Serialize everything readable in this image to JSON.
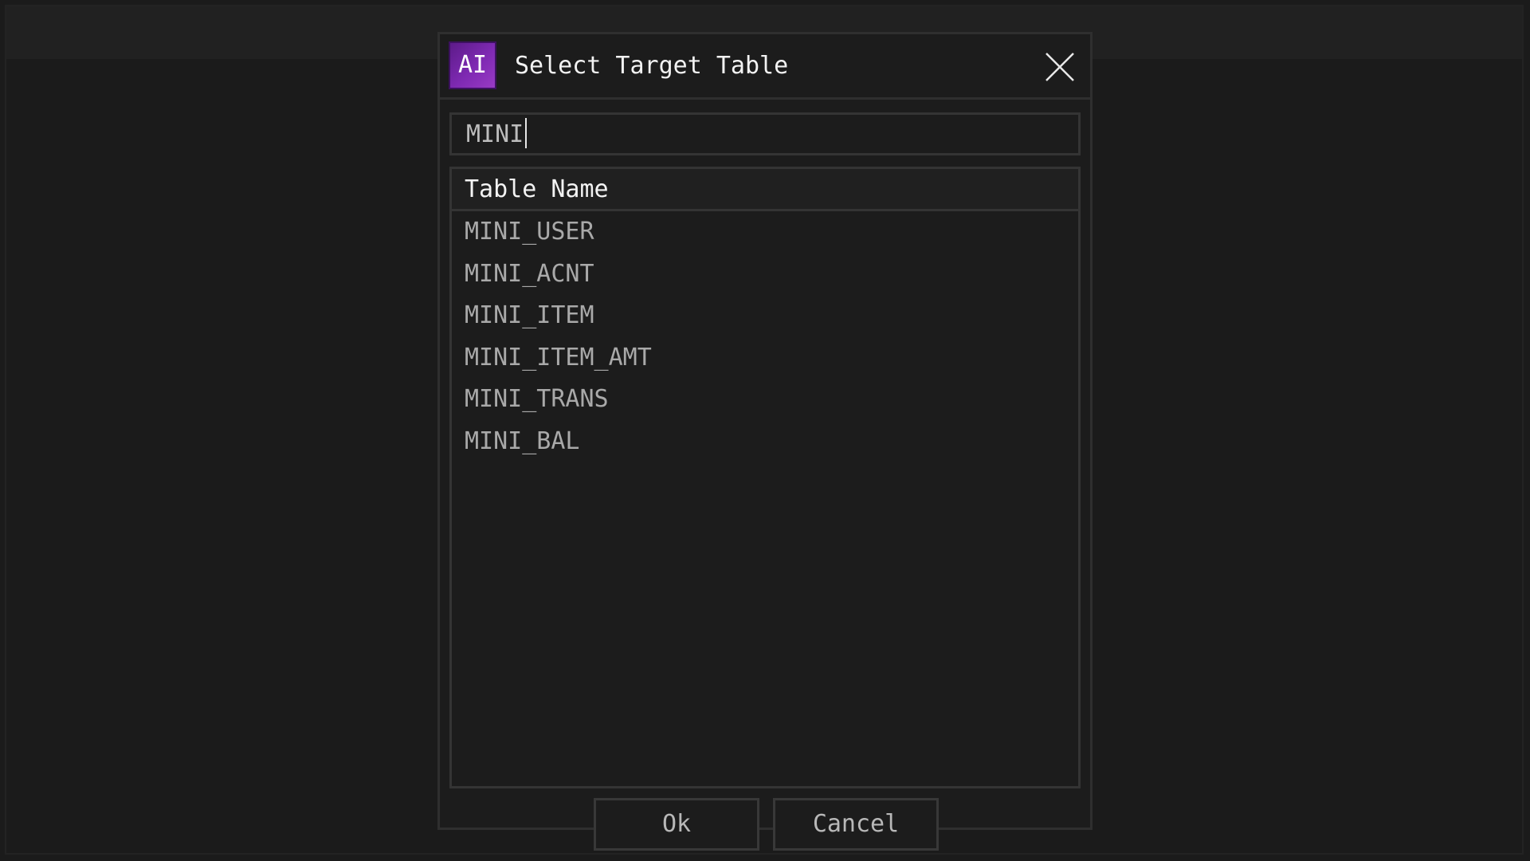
{
  "dialog": {
    "icon_label": "AI",
    "title": "Select Target Table"
  },
  "search": {
    "value": "MINI"
  },
  "table": {
    "column_header": "Table Name",
    "rows": [
      "MINI_USER",
      "MINI_ACNT",
      "MINI_ITEM",
      "MINI_ITEM_AMT",
      "MINI_TRANS",
      "MINI_BAL"
    ]
  },
  "buttons": {
    "ok_label": "Ok",
    "cancel_label": "Cancel"
  },
  "colors": {
    "accent": "#7f2ab3",
    "background": "#1c1c1c",
    "border": "#343434"
  },
  "icons": {
    "close": "close-icon",
    "app": "ai-app-icon"
  }
}
